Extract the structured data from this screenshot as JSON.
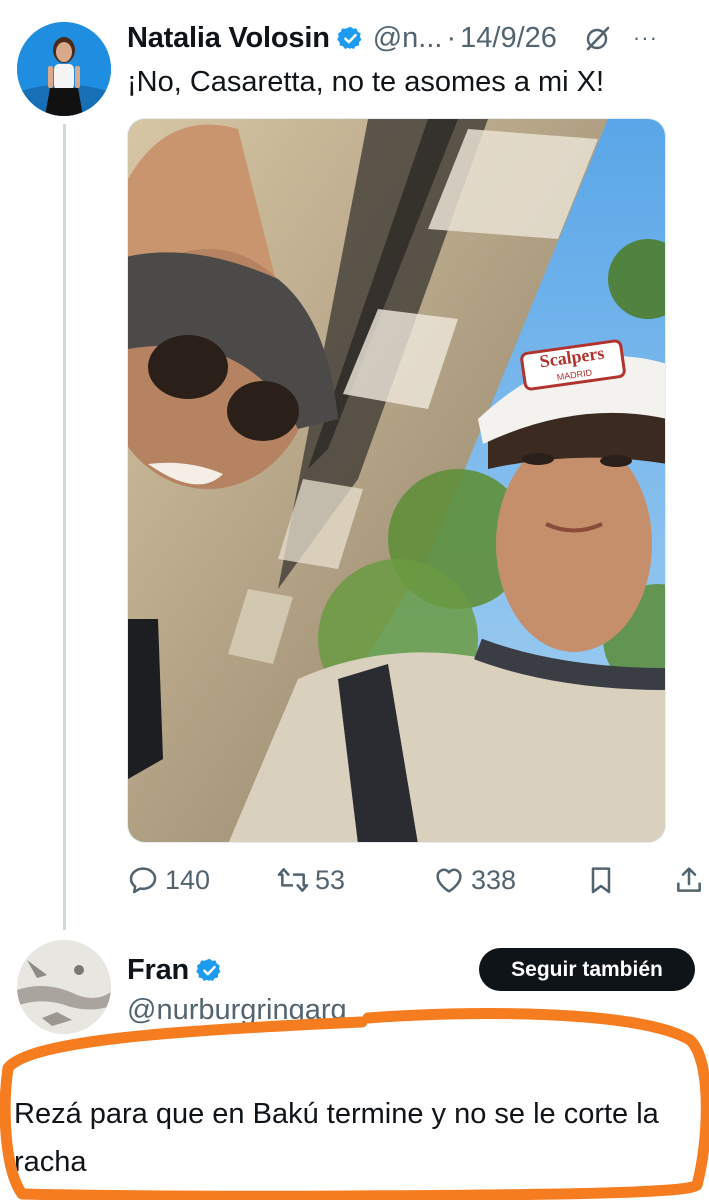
{
  "tweet": {
    "author_name": "Natalia Volosin",
    "handle": "@n...",
    "separator": "·",
    "date": "14/9/26",
    "more_glyph": "···",
    "text": "¡No, Casaretta, no te asomes a mi X!",
    "actions": {
      "replies": "140",
      "reposts": "53",
      "likes": "338"
    },
    "icons": [
      "verified-badge-icon",
      "grok-icon",
      "more-icon",
      "reply-icon",
      "repost-icon",
      "like-icon",
      "bookmark-icon",
      "share-icon"
    ]
  },
  "photo_text": {
    "cap_brand": "Scalpers",
    "cap_sub": "MADRID"
  },
  "reply": {
    "author_name": "Fran",
    "handle": "@nurburgringarg",
    "follow_label": "Seguir también",
    "text": "Rezá para que en Bakú termine y no se le corte la racha"
  },
  "colors": {
    "accent": "#1d9bf0",
    "muted": "#536471",
    "highlight": "#f57c1f",
    "button": "#0f1419"
  }
}
